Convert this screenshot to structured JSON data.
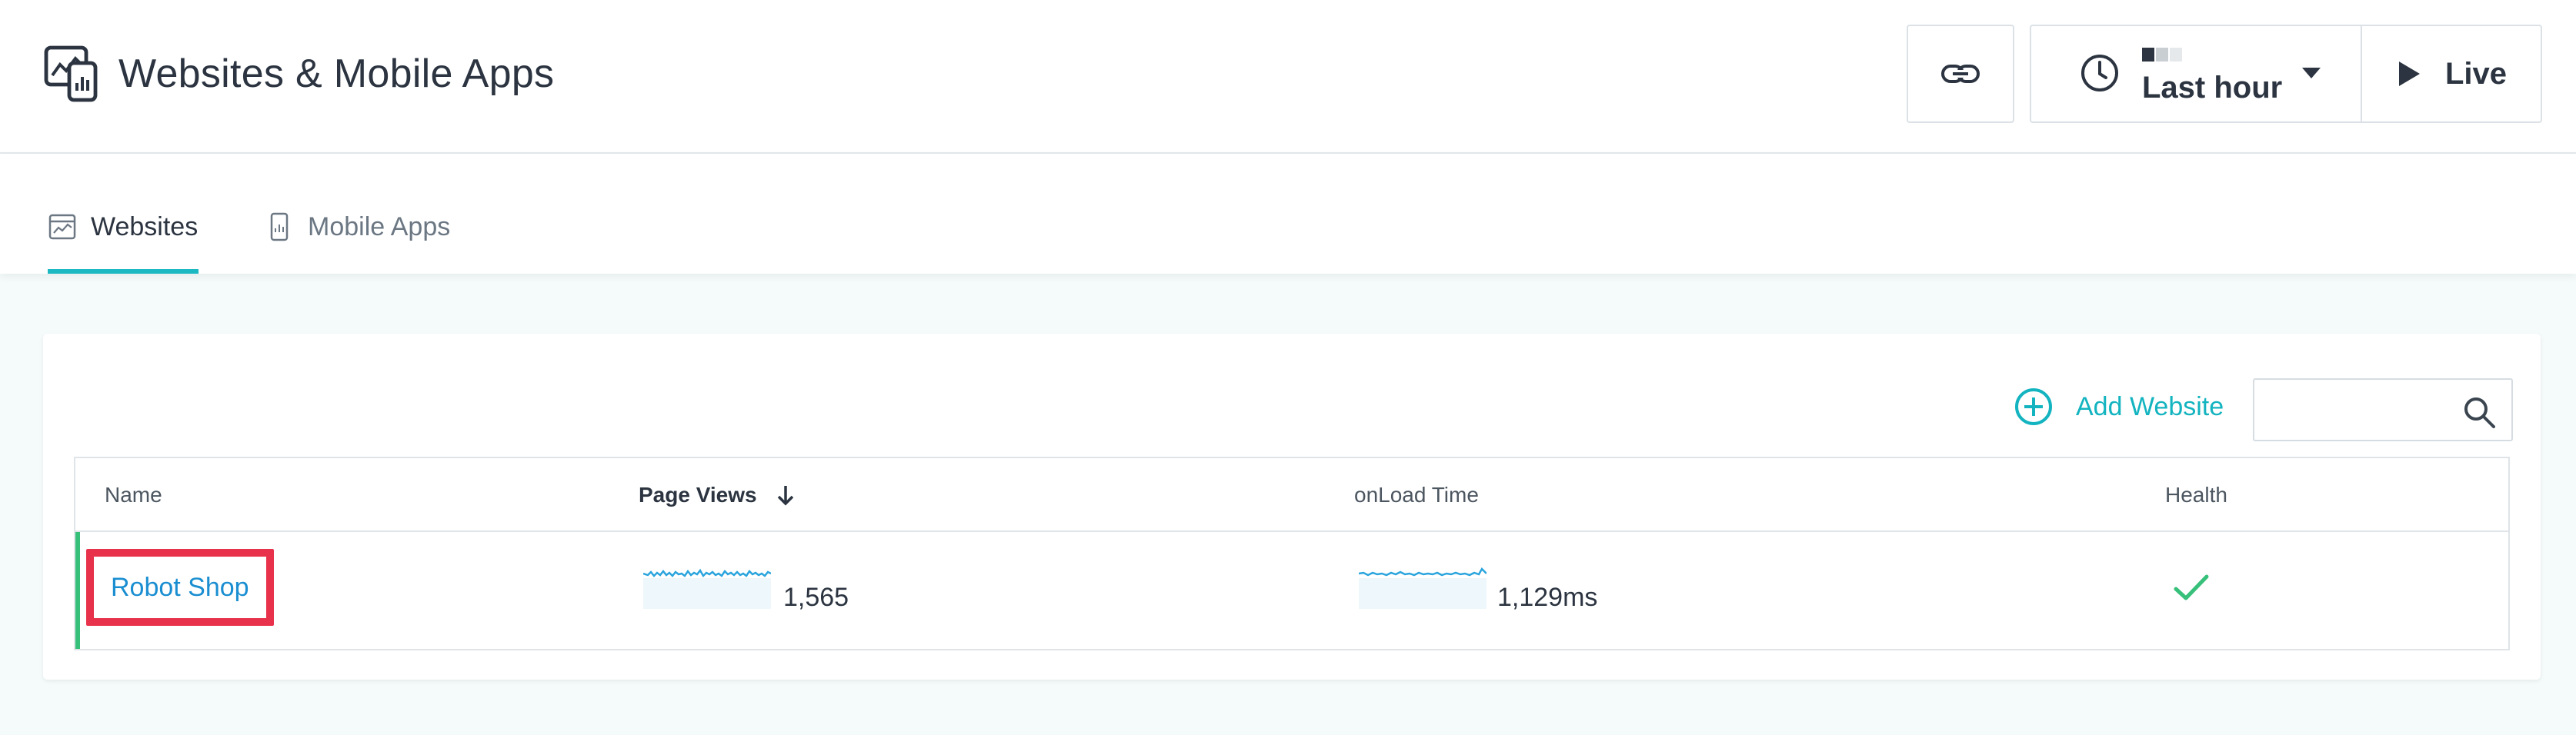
{
  "header": {
    "title": "Websites & Mobile Apps",
    "app_icon": "websites-apps-icon",
    "link_icon": "link-icon",
    "time_picker": {
      "label": "Last hour",
      "icon": "clock-icon"
    },
    "live": {
      "label": "Live",
      "icon": "play-icon"
    }
  },
  "tabs": [
    {
      "label": "Websites",
      "icon": "website-icon",
      "active": true
    },
    {
      "label": "Mobile Apps",
      "icon": "mobile-app-icon",
      "active": false
    }
  ],
  "toolbar": {
    "add_label": "Add Website",
    "search_placeholder": ""
  },
  "table": {
    "columns": [
      "Name",
      "Page Views",
      "onLoad Time",
      "Health"
    ],
    "sorted_column": "Page Views",
    "sort_direction": "descending",
    "rows": [
      {
        "name": "Robot Shop",
        "page_views": "1,565",
        "onload_time": "1,129ms",
        "health": "healthy"
      }
    ]
  },
  "colors": {
    "accent": "#1cb9c3",
    "link": "#1a8ed1",
    "health_ok": "#37c07a",
    "highlight": "#e8314a",
    "sparkline": "#2aa4dd"
  }
}
